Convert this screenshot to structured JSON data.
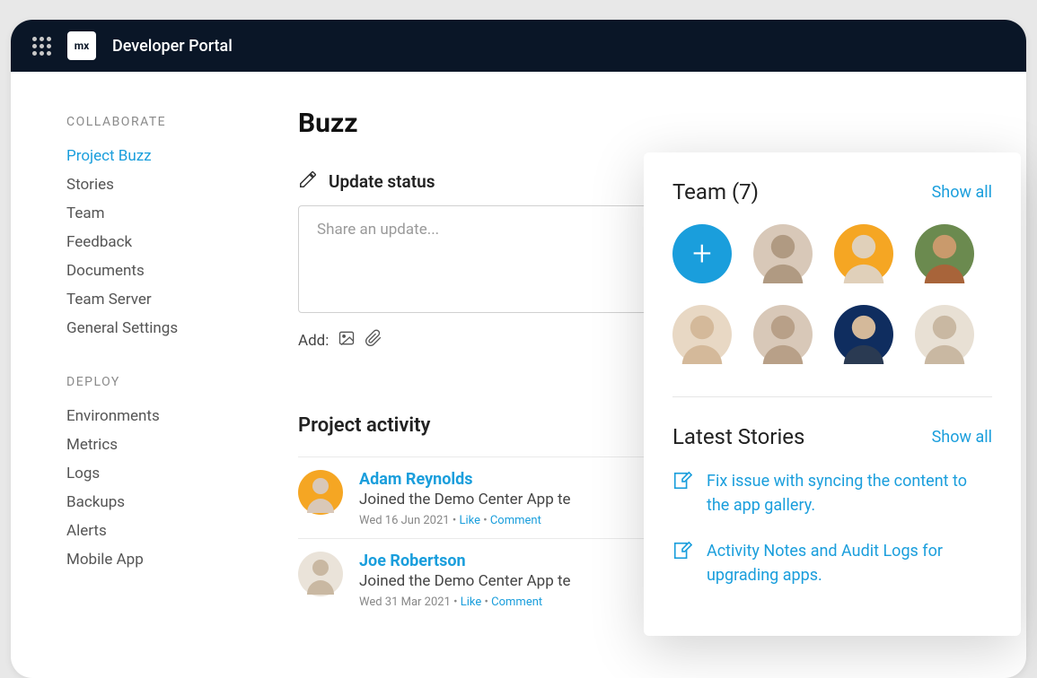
{
  "header": {
    "logo_text": "mx",
    "title": "Developer Portal"
  },
  "sidebar": {
    "collaborate": {
      "label": "COLLABORATE",
      "items": [
        {
          "label": "Project Buzz",
          "active": true
        },
        {
          "label": "Stories"
        },
        {
          "label": "Team"
        },
        {
          "label": "Feedback"
        },
        {
          "label": "Documents"
        },
        {
          "label": "Team Server"
        },
        {
          "label": "General Settings"
        }
      ]
    },
    "deploy": {
      "label": "DEPLOY",
      "items": [
        {
          "label": "Environments"
        },
        {
          "label": "Metrics"
        },
        {
          "label": "Logs"
        },
        {
          "label": "Backups"
        },
        {
          "label": "Alerts"
        },
        {
          "label": "Mobile App"
        }
      ]
    }
  },
  "main": {
    "title": "Buzz",
    "update_label": "Update status",
    "status_placeholder": "Share an update...",
    "add_label": "Add:",
    "activity_title": "Project activity",
    "activities": [
      {
        "name": "Adam Reynolds",
        "text": "Joined the Demo Center App te",
        "date": "Wed 16 Jun 2021",
        "like": "Like",
        "comment": "Comment",
        "bg": "#f5a623"
      },
      {
        "name": "Joe Robertson",
        "text": "Joined the Demo Center App te",
        "date": "Wed 31 Mar 2021",
        "like": "Like",
        "comment": "Comment",
        "bg": "#eae3d9"
      }
    ]
  },
  "panel": {
    "team_title": "Team (7)",
    "showall": "Show all",
    "team_colors": [
      "#1a9edc",
      "#d8c8b8",
      "#f5a623",
      "#a88c6c",
      "#e8d8c4",
      "#c9b8a2",
      "#0f2d5f",
      "#e8e0d4"
    ],
    "stories_title": "Latest Stories",
    "stories": [
      {
        "text": "Fix issue with syncing the content to the app gallery."
      },
      {
        "text": "Activity Notes and Audit Logs for upgrading apps."
      }
    ]
  },
  "dot": "•"
}
